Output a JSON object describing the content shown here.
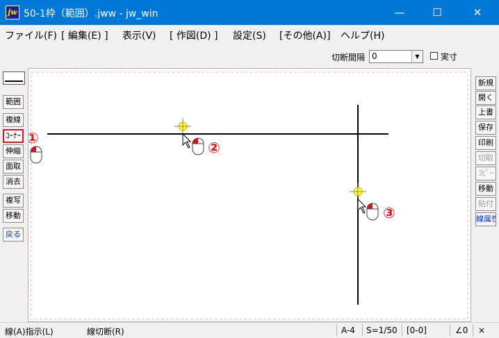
{
  "window": {
    "title": "50-1枠（範囲）.jww - jw_win",
    "app_icon_text": "jw",
    "controls": {
      "minimize": "—",
      "maximize": "☐",
      "close": "✕"
    }
  },
  "menu": [
    "ファイル(F)",
    "[ 編集(E) ]",
    "表示(V)",
    "[ 作図(D) ]",
    "設定(S)",
    "[その他(A)]",
    "ヘルプ(H)"
  ],
  "toolbar": {
    "cut_interval_label": "切断間隔",
    "cut_interval_value": "0",
    "actual_size_label": "実寸",
    "actual_size_checked": false
  },
  "left_tools": [
    "範囲",
    "複線",
    "ｺｰﾅｰ",
    "伸縮",
    "面取",
    "消去",
    "複写",
    "移動",
    "戻る"
  ],
  "left_tools_selected": "ｺｰﾅｰ",
  "right_tools": [
    {
      "label": "新規",
      "enabled": true
    },
    {
      "label": "開く",
      "enabled": true
    },
    {
      "label": "上書",
      "enabled": true
    },
    {
      "label": "保存",
      "enabled": true
    },
    {
      "label": "印刷",
      "enabled": true
    },
    {
      "label": "切取",
      "enabled": false
    },
    {
      "label": "ｺﾋﾟｰ",
      "enabled": false
    },
    {
      "label": "移動",
      "enabled": true
    },
    {
      "label": "貼付",
      "enabled": false
    },
    {
      "label": "線属性",
      "enabled": true
    }
  ],
  "annotations": {
    "step1": "①",
    "step2": "②",
    "step3": "③"
  },
  "status": {
    "instruction": "線(A)指示(L)",
    "mode": "線切断(R)",
    "paper": "A-4",
    "scale": "S=1/50",
    "layer": "[0-0]",
    "angle": "∠0",
    "zoom": "×"
  },
  "colors": {
    "title_bar": "#0078d7",
    "highlight": "#e0141e",
    "point_marker": "#ffff66"
  }
}
